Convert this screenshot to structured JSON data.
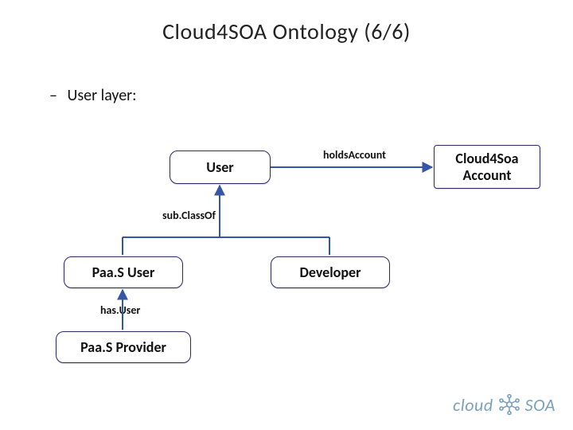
{
  "title": "Cloud4SOA Ontology (6/6)",
  "bullet": {
    "dash": "–",
    "label": "User layer:"
  },
  "nodes": {
    "user": "User",
    "account": "Cloud4Soa Account",
    "paasUser": "Paa.S User",
    "developer": "Developer",
    "paasProvider": "Paa.S Provider"
  },
  "edges": {
    "holdsAccount": "holdsAccount",
    "subClassOf": "sub.ClassOf",
    "hasUser": "has.User"
  },
  "logo": {
    "word1": "cloud",
    "word2": "SOA"
  }
}
